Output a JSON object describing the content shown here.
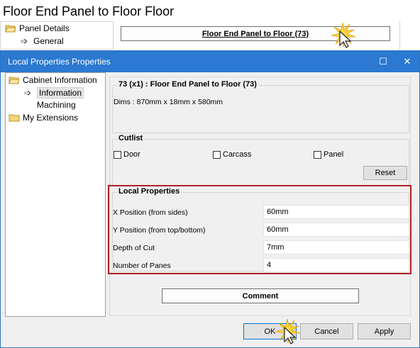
{
  "background": {
    "title": "Floor End Panel to Floor Floor",
    "tree": {
      "panel_details": "Panel Details",
      "general": "General"
    },
    "main_button": "Floor End Panel to Floor (73)"
  },
  "dialog": {
    "title": "Local Properties Properties",
    "maximize_glyph": "☐",
    "close_glyph": "✕",
    "tree": {
      "cabinet_information": "Cabinet Information",
      "information": "Information",
      "machining": "Machining",
      "my_extensions": "My Extensions"
    },
    "panel_info": {
      "title": "73 (x1) : Floor End Panel to Floor (73)",
      "dims": "Dims : 870mm x 18mm x 580mm"
    },
    "cutlist": {
      "title": "Cutlist",
      "door": "Door",
      "carcass": "Carcass",
      "panel": "Panel",
      "reset": "Reset"
    },
    "local_properties": {
      "title": "Local Properties",
      "fields": [
        {
          "label": "X Position (from sides)",
          "value": "60mm"
        },
        {
          "label": "Y Position (from top/bottom)",
          "value": "60mm"
        },
        {
          "label": "Depth of Cut",
          "value": "7mm"
        },
        {
          "label": "Number of Panes",
          "value": "4"
        }
      ]
    },
    "comment_button": "Comment",
    "footer": {
      "ok": "OK",
      "cancel": "Cancel",
      "apply": "Apply"
    }
  },
  "colors": {
    "titlebar": "#2b79d0",
    "highlight_border": "#b12025"
  }
}
